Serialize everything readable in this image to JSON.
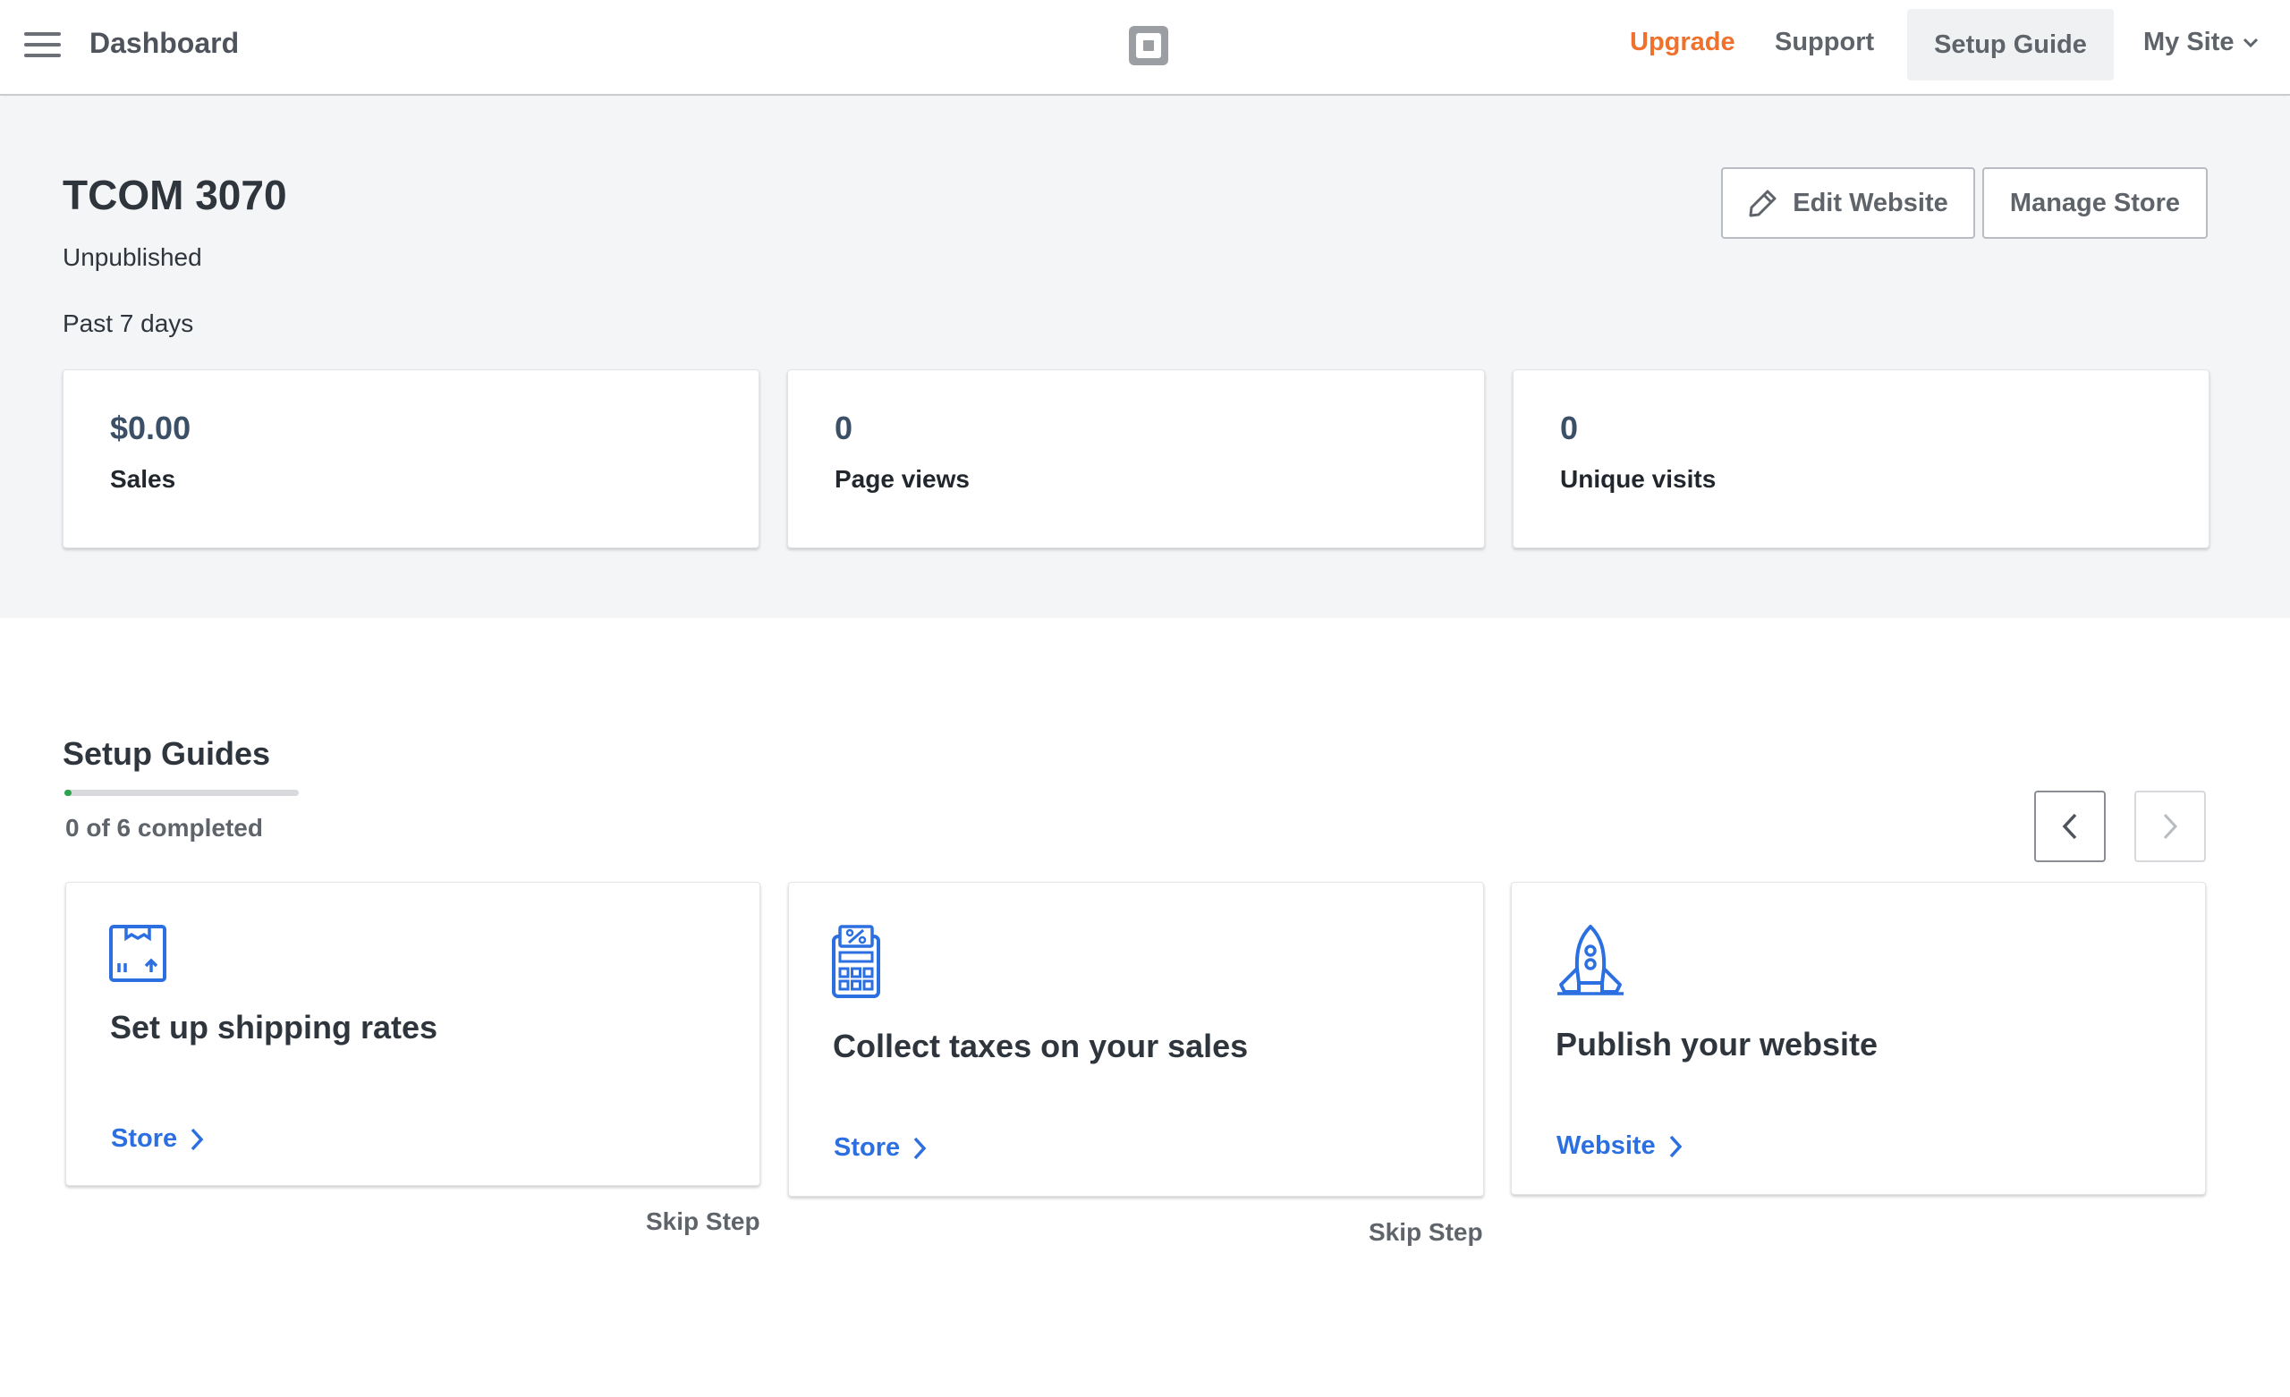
{
  "header": {
    "title": "Dashboard",
    "nav": {
      "upgrade": "Upgrade",
      "support": "Support",
      "setup_guide": "Setup Guide",
      "my_site": "My Site"
    },
    "colors": {
      "upgrade": "#f0712d"
    }
  },
  "site": {
    "title": "TCOM 3070",
    "status": "Unpublished",
    "period": "Past 7 days",
    "actions": {
      "edit_website": "Edit Website",
      "manage_store": "Manage Store"
    }
  },
  "stats": [
    {
      "value": "$0.00",
      "label": "Sales"
    },
    {
      "value": "0",
      "label": "Page views"
    },
    {
      "value": "0",
      "label": "Unique visits"
    }
  ],
  "guides": {
    "title": "Setup Guides",
    "progress_text": "0 of 6 completed",
    "progress_fraction": 0.03,
    "progress_color": "#2ea44f",
    "items": [
      {
        "icon": "shipping-box-icon",
        "title": "Set up shipping rates",
        "link": "Store",
        "skip": "Skip Step"
      },
      {
        "icon": "tax-calculator-icon",
        "title": "Collect taxes on your sales",
        "link": "Store",
        "skip": "Skip Step"
      },
      {
        "icon": "rocket-icon",
        "title": "Publish your website",
        "link": "Website"
      }
    ],
    "link_color": "#2c6fe0"
  }
}
